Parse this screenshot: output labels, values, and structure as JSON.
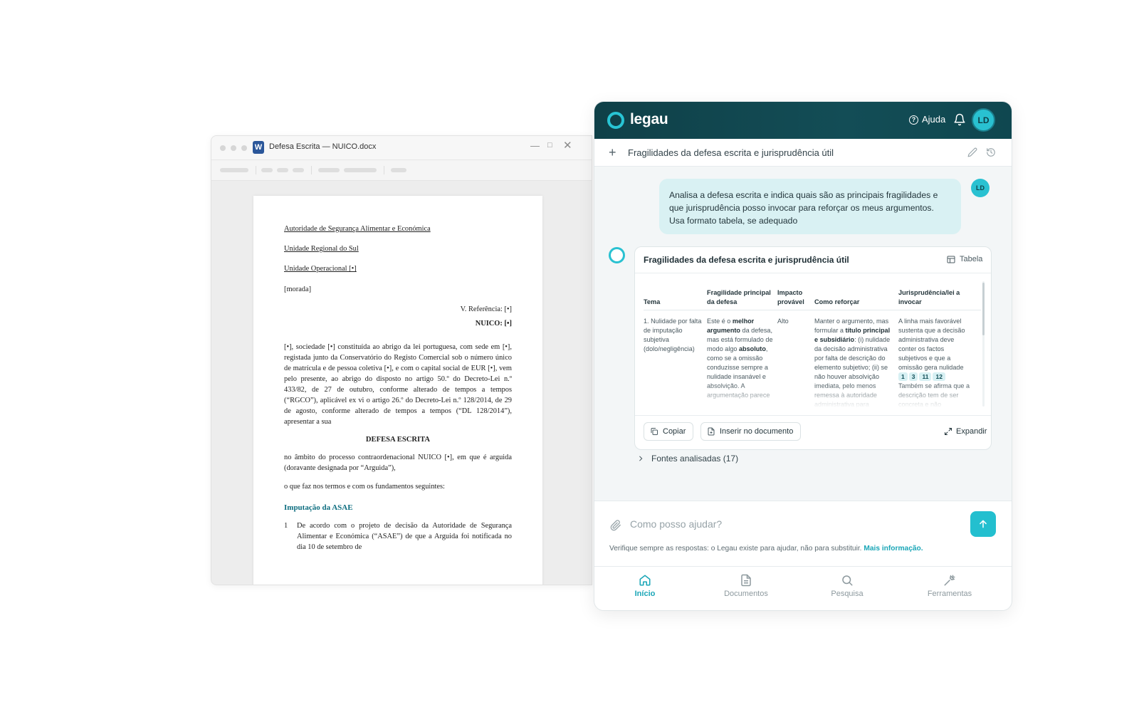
{
  "word": {
    "title": "Defesa Escrita — NUICO.docx",
    "app_badge": "W",
    "doc": {
      "address": [
        "Autoridade de Segurança Alimentar e Económica",
        "Unidade Regional do Sul",
        "Unidade Operacional [•]"
      ],
      "morada": "[morada]",
      "ref": "V. Referência: [•]",
      "nuico": "NUICO: [•]",
      "para1": "[•], sociedade [•] constituída ao abrigo da lei portuguesa, com sede em [•], registada junto da Conservatório do Registo Comercial sob o número único de matrícula e de pessoa coletiva [•], e com o capital social de EUR [•], vem pelo presente, ao abrigo do disposto no artigo 50.º do Decreto-Lei n.º 433/82, de 27 de outubro, conforme alterado de tempos a tempos (“RGCO”), aplicável ex vi o artigo 26.º do Decreto-Lei n.º 128/2014, de 29 de agosto, conforme alterado de tempos a tempos (“DL 128/2014”), apresentar a sua",
      "title": "DEFESA ESCRITA",
      "para2": "no âmbito do processo contraordenacional NUICO [•], em que é arguida (doravante designada por “Arguida”),",
      "para3": "o que faz nos termos e com os fundamentos seguintes:",
      "heading": "Imputação da ASAE",
      "item1_num": "1",
      "item1": "De acordo com o projeto de decisão da Autoridade de Segurança Alimentar e Económica (“ASAE”) de que a Arguida foi notificada no dia 10 de setembro de"
    }
  },
  "legau": {
    "brand": "legau",
    "help": "Ajuda",
    "avatar": "LD",
    "conversation_title": "Fragilidades da defesa escrita e jurisprudência útil",
    "user_message": "Analisa a defesa escrita e indica quais são as principais fragilidades e que jurisprudência posso invocar para reforçar os meus argumentos. Usa formato tabela, se adequado",
    "user_avatar": "LD",
    "card": {
      "title": "Fragilidades da defesa escrita e jurisprudência útil",
      "view_label": "Tabela",
      "columns": [
        "Tema",
        "Fragilidade principal da defesa",
        "Impacto provável",
        "Como reforçar",
        "Jurisprudência/lei a invocar"
      ],
      "row": {
        "tema": "1. Nulidade por falta de imputação subjetiva (dolo/negligência)",
        "fragilidade": [
          "Este é o ",
          "melhor argumento",
          " da defesa, mas está formulado de modo algo ",
          "absoluto",
          ", como se a omissão conduzisse sempre a nulidade insanável e absolvição. A argumentação parece"
        ],
        "impacto": "Alto",
        "reforcar": [
          "Manter o argumento, mas formular a ",
          "título principal e subsidiário",
          ": (i) nulidade da decisão administrativa por falta de descrição do elemento subjetivo; (ii) se não houver absolvição imediata, pelo menos remessa à autoridade administrativa para"
        ],
        "jurisprudencia": "A linha mais favorável sustenta que a decisão administrativa deve conter os factos subjetivos e que a omissão gera nulidade",
        "refs": [
          "1",
          "3",
          "11",
          "12"
        ],
        "jurisprudencia_cont": "Também se afirma que a descrição tem de ser concreta e não"
      },
      "copy": "Copiar",
      "insert": "Inserir no documento",
      "expand": "Expandir"
    },
    "sources": "Fontes analisadas (17)",
    "composer": {
      "placeholder": "Como posso ajudar?",
      "disclaimer": "Verifique sempre as respostas: o Legau existe para ajudar, não para substituir.",
      "more": "Mais informação."
    },
    "nav": [
      "Início",
      "Documentos",
      "Pesquisa",
      "Ferramentas"
    ],
    "colors": {
      "accent": "#23bfcf",
      "header": "#134d56",
      "bubble": "#d9f1f3"
    }
  }
}
